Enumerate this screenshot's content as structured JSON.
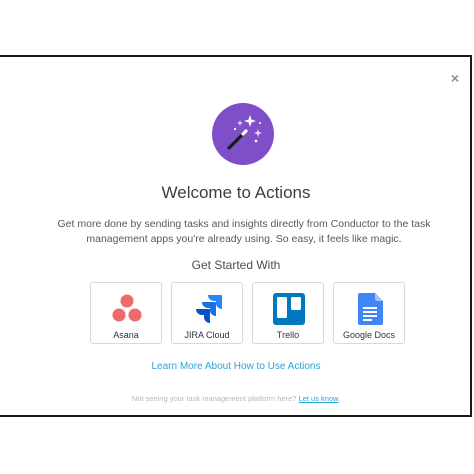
{
  "modal": {
    "close_label": "×",
    "hero_icon": "magic-wand-icon",
    "title": "Welcome to Actions",
    "description": "Get more done by sending tasks and insights directly from Conductor to the task management apps you're already using. So easy, it feels like magic.",
    "subtitle": "Get Started With",
    "apps": [
      {
        "label": "Asana",
        "icon": "asana-logo-icon",
        "color": "#f06a6a"
      },
      {
        "label": "JIRA Cloud",
        "icon": "jira-logo-icon",
        "color": "#2684ff"
      },
      {
        "label": "Trello",
        "icon": "trello-logo-icon",
        "color": "#0079bf"
      },
      {
        "label": "Google Docs",
        "icon": "google-docs-logo-icon",
        "color": "#4285f4"
      }
    ],
    "learn_more": "Learn More About How to Use Actions",
    "footer_text": "Not seeing your task management platform here?",
    "footer_link": "Let us know",
    "footer_end": "."
  },
  "colors": {
    "hero_bg": "#7e4fc9",
    "link": "#2aa3d6"
  }
}
